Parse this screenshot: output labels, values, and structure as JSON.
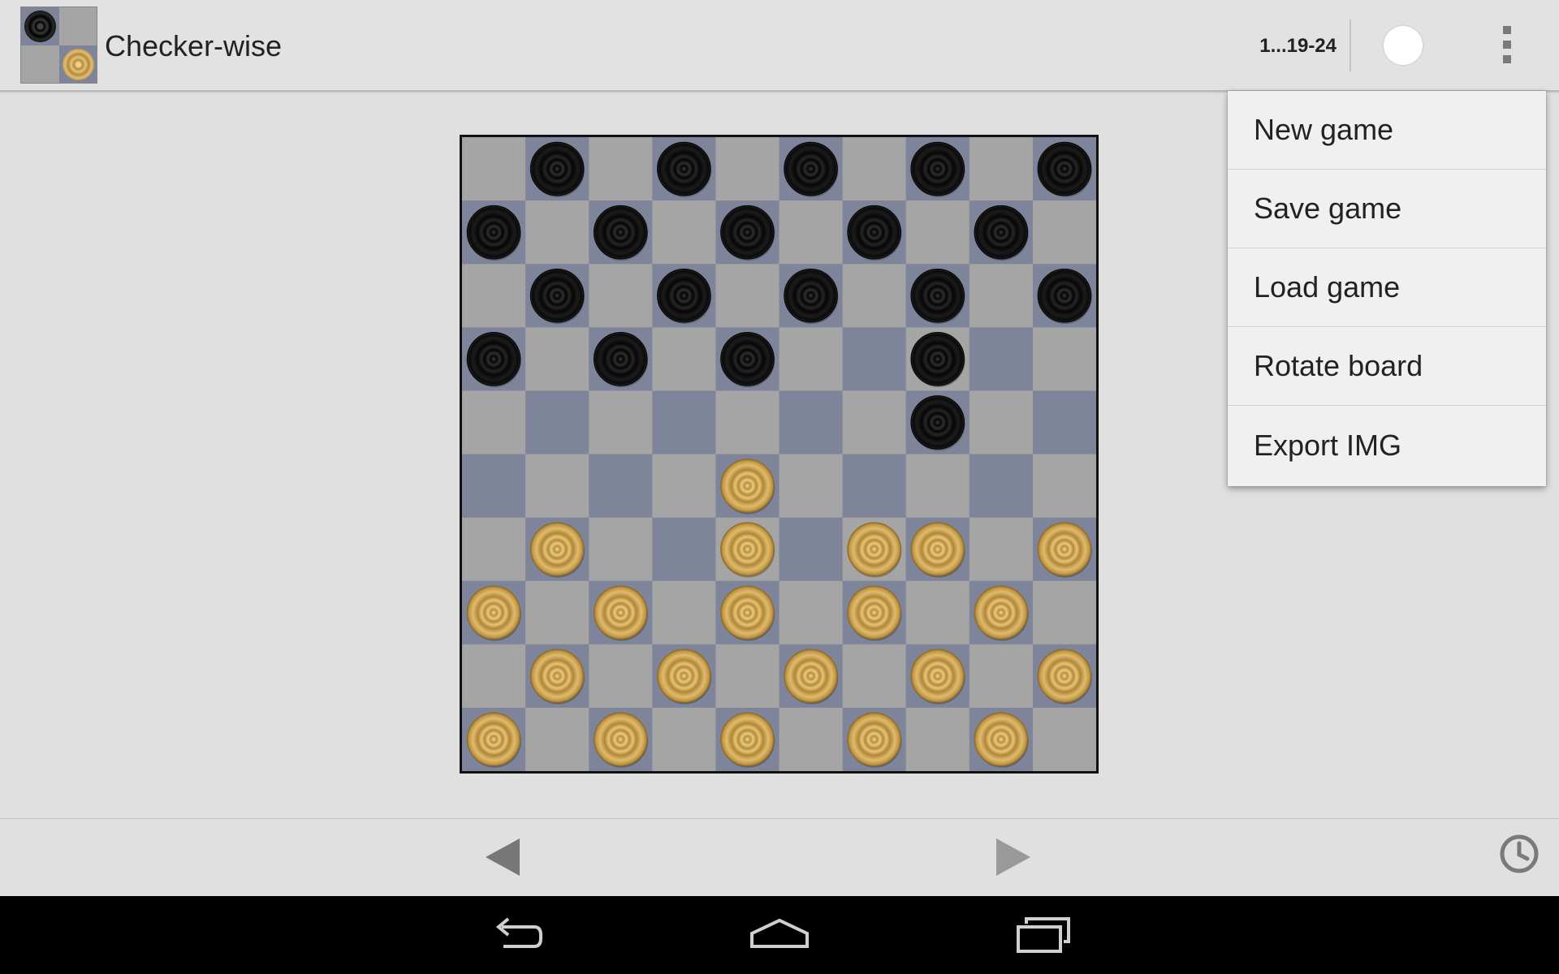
{
  "app": {
    "title": "Checker-wise",
    "move_text": "1...19-24",
    "turn": "white",
    "icon_name": "checkers-app-icon"
  },
  "menu": {
    "items": [
      {
        "label": "New game"
      },
      {
        "label": "Save game"
      },
      {
        "label": "Load game"
      },
      {
        "label": "Rotate board"
      },
      {
        "label": "Export IMG"
      }
    ]
  },
  "board": {
    "size": 10,
    "rows": [
      ".b.b.b.b.b",
      "b.b.b.b.b.",
      ".b.b.b.b.b",
      "b.b.b..b.",
      ".......b..",
      "....w.....",
      ".w..w.ww.w",
      "w.w.w.w.w.",
      ".w.w.w.w.w",
      "w.w.w.w.w."
    ],
    "highlight_squares": [
      [
        3,
        6
      ],
      [
        4,
        1
      ],
      [
        4,
        3
      ],
      [
        4,
        5
      ],
      [
        4,
        9
      ],
      [
        5,
        0
      ],
      [
        5,
        2
      ],
      [
        5,
        6
      ],
      [
        5,
        8
      ],
      [
        6,
        3
      ]
    ]
  },
  "colors": {
    "light_square": "#a5a5a5",
    "dark_square": "#7e8499",
    "highlight_square": "#7e8499",
    "black_piece": "#141414",
    "white_piece": "#d6b061",
    "background": "#e0e0e0"
  },
  "toolbar": {
    "prev_icon": "prev-move-icon",
    "next_icon": "next-move-icon",
    "clock_icon": "clock-icon"
  },
  "system_nav": {
    "back_icon": "back-icon",
    "home_icon": "home-icon",
    "recents_icon": "recent-apps-icon"
  }
}
